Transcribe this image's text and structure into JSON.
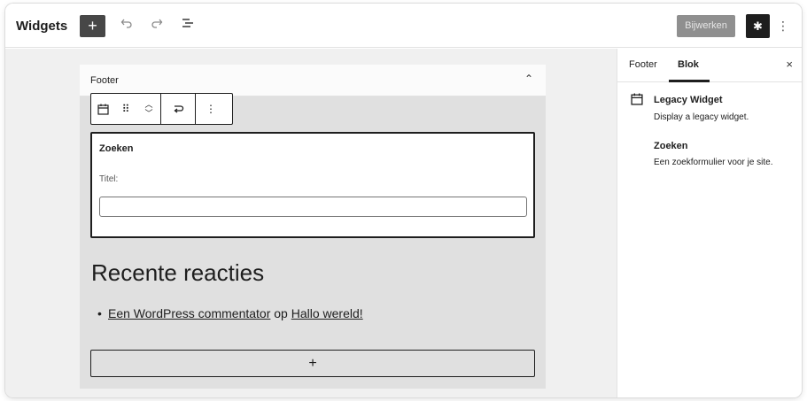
{
  "header": {
    "title": "Widgets",
    "add_label": "+",
    "update_label": "Bijwerken",
    "icons": {
      "undo": "undo-icon",
      "redo": "redo-icon",
      "list": "list-view-icon",
      "settings": "gear-icon",
      "more": "more-vertical-icon"
    }
  },
  "canvas": {
    "area_title": "Footer",
    "toolbar": {
      "icons": [
        "calendar-icon",
        "drag-handle-icon",
        "move-up-down-icon",
        "transform-icon",
        "more-vertical-icon"
      ]
    },
    "widget": {
      "title": "Zoeken",
      "field_label": "Titel:",
      "field_value": ""
    },
    "recent": {
      "heading": "Recente reacties",
      "author_link": "Een WordPress commentator",
      "connector": " op ",
      "post_link": "Hallo wereld!"
    },
    "appender_label": "+"
  },
  "sidebar": {
    "tabs": [
      "Footer",
      "Blok"
    ],
    "active_tab": "Blok",
    "close_label": "×",
    "block": {
      "name": "Legacy Widget",
      "description": "Display a legacy widget."
    },
    "widget": {
      "name": "Zoeken",
      "description": "Een zoekformulier voor je site."
    }
  }
}
